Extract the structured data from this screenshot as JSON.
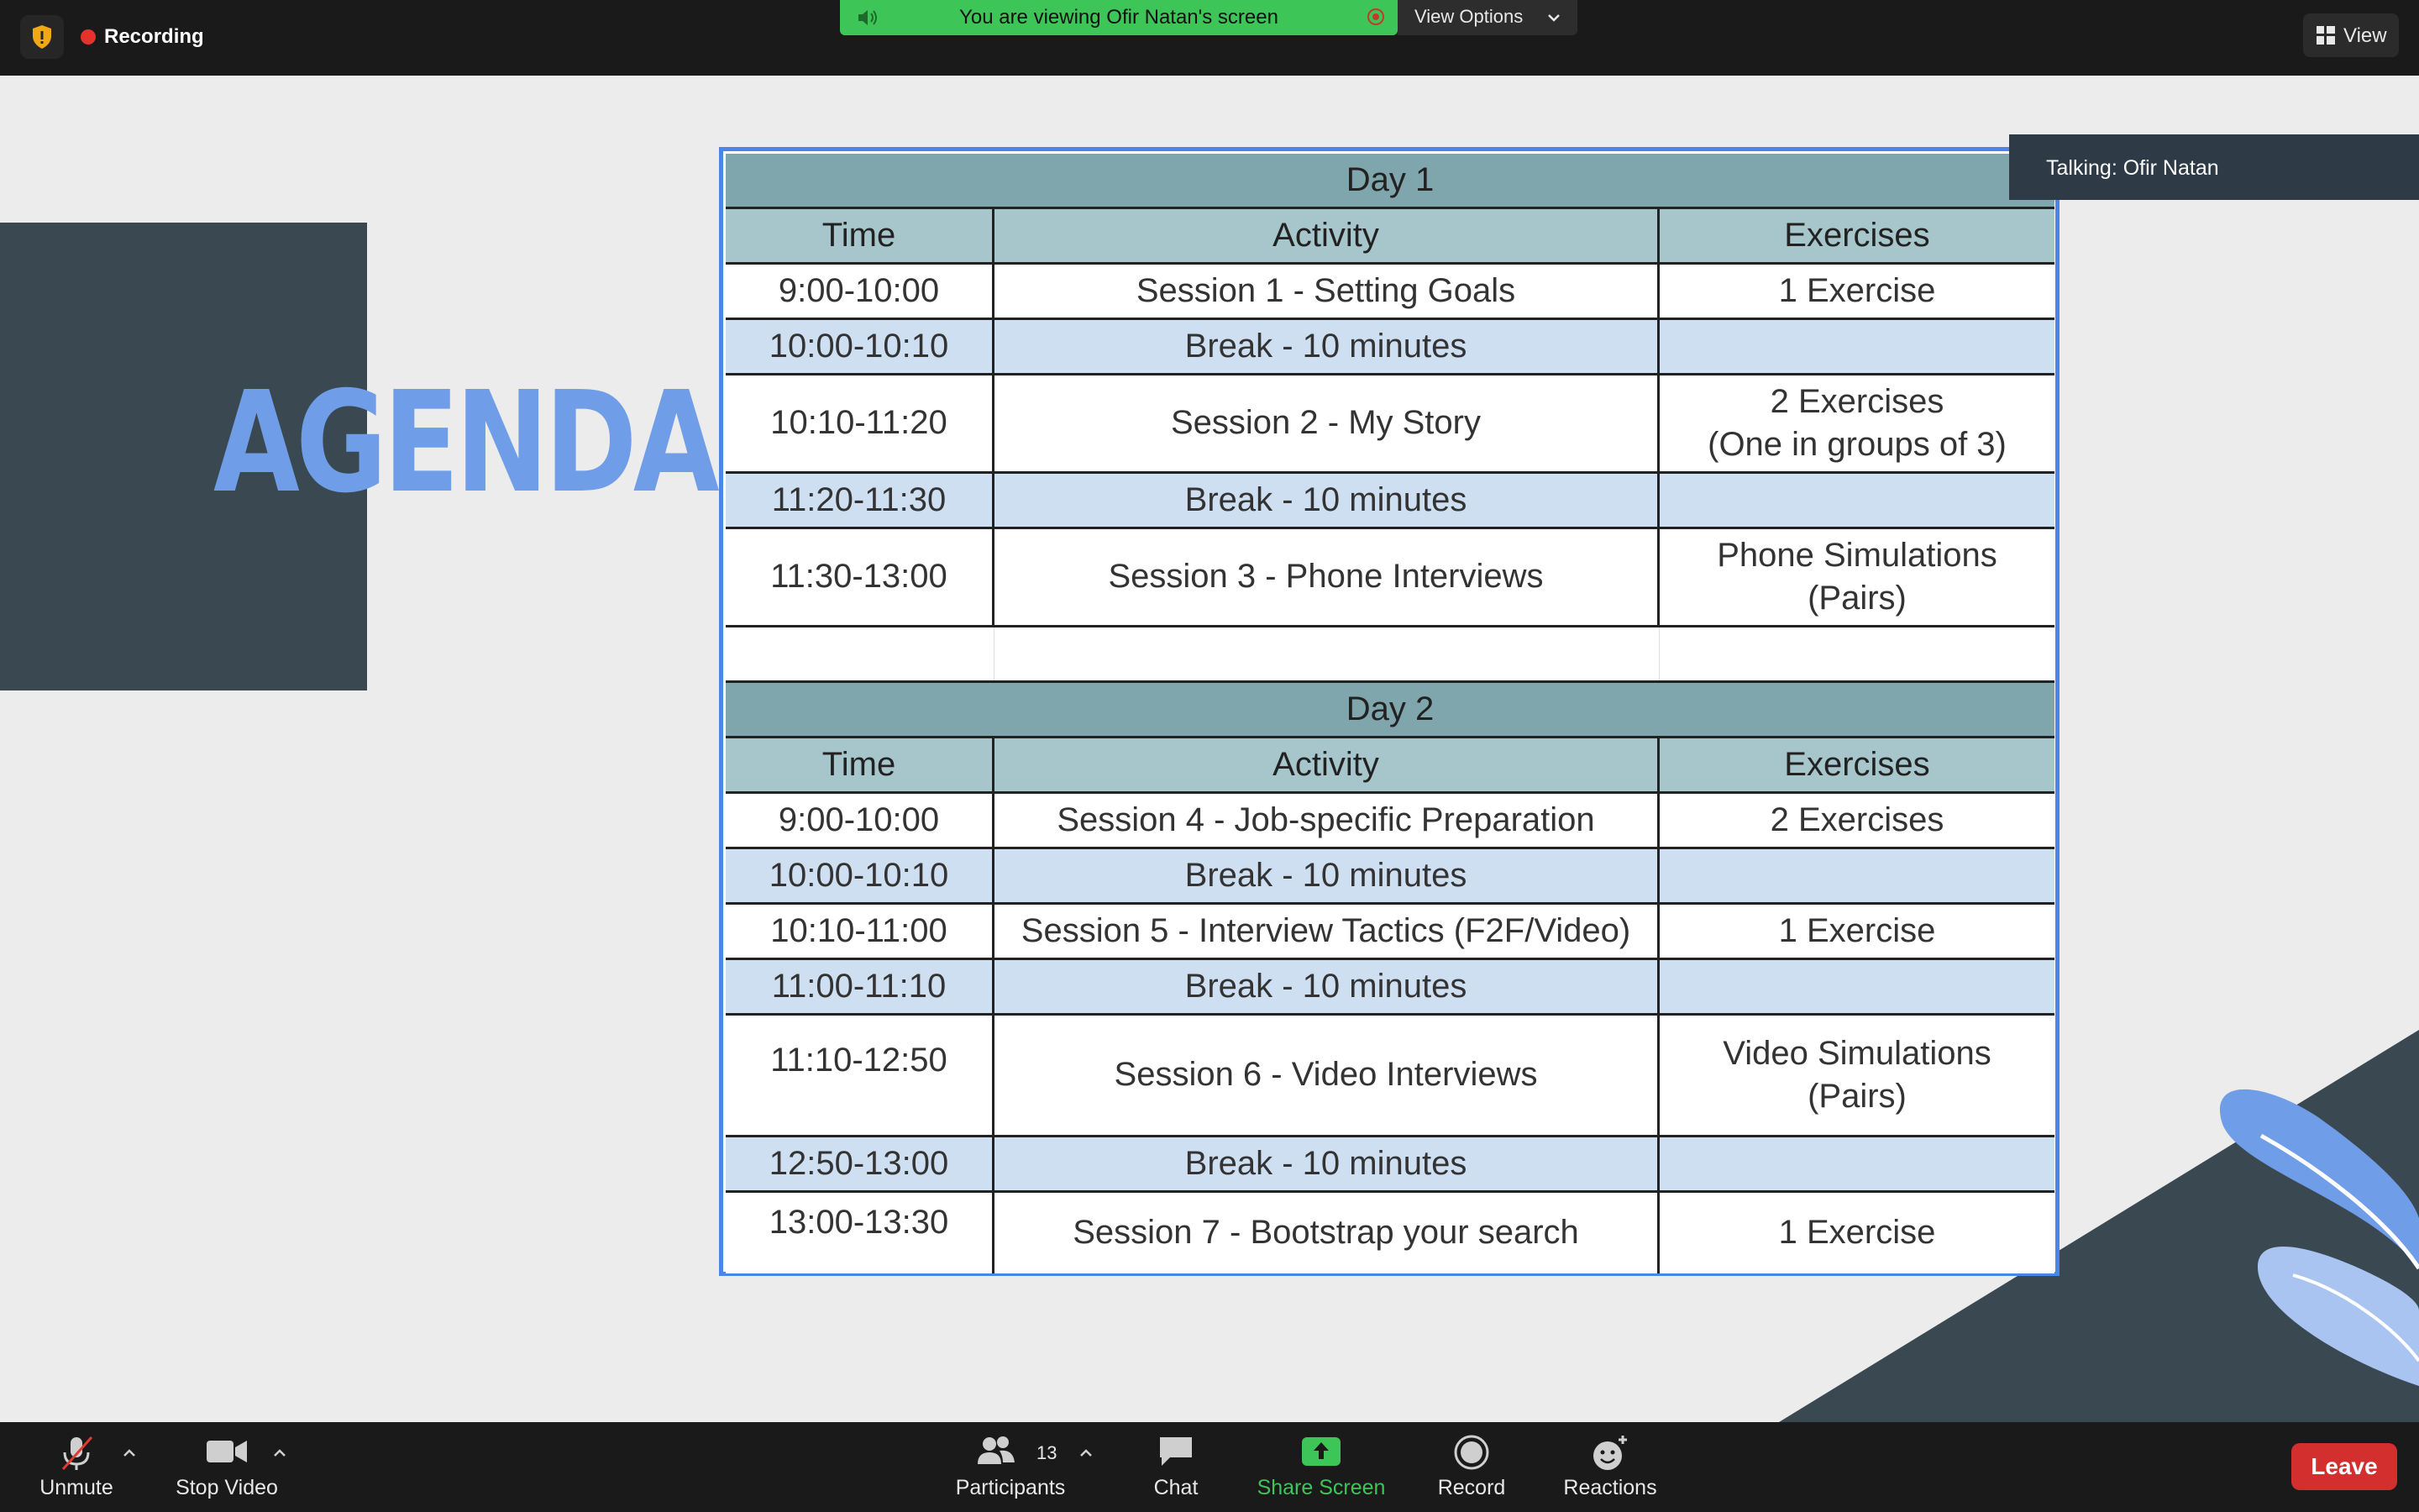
{
  "topbar": {
    "recording_label": "Recording",
    "banner_text": "You are viewing Ofir Natan's screen",
    "view_options_label": "View Options",
    "view_label": "View"
  },
  "slide": {
    "title": "AGENDA",
    "talking": "Talking: Ofir Natan",
    "accent_color": "#6f9de8",
    "dark_color": "#3a4852"
  },
  "schedule": {
    "day1": {
      "title": "Day 1",
      "headers": [
        "Time",
        "Activity",
        "Exercises"
      ],
      "rows": [
        {
          "time": "9:00-10:00",
          "activity": "Session 1 - Setting Goals",
          "exercises": "1 Exercise"
        },
        {
          "time": "10:00-10:10",
          "activity": "Break - 10 minutes",
          "exercises": ""
        },
        {
          "time": "10:10-11:20",
          "activity": "Session 2  - My Story",
          "exercises": "2 Exercises\n(One in groups of 3)"
        },
        {
          "time": "11:20-11:30",
          "activity": "Break - 10 minutes",
          "exercises": ""
        },
        {
          "time": "11:30-13:00",
          "activity": "Session 3 - Phone Interviews",
          "exercises": "Phone Simulations\n(Pairs)"
        }
      ]
    },
    "day2": {
      "title": "Day 2",
      "headers": [
        "Time",
        "Activity",
        "Exercises"
      ],
      "rows": [
        {
          "time": "9:00-10:00",
          "activity": "Session 4 - Job-specific Preparation",
          "exercises": "2 Exercises"
        },
        {
          "time": "10:00-10:10",
          "activity": "Break - 10 minutes",
          "exercises": ""
        },
        {
          "time": "10:10-11:00",
          "activity": "Session 5 - Interview Tactics (F2F/Video)",
          "exercises": "1 Exercise"
        },
        {
          "time": "11:00-11:10",
          "activity": "Break - 10 minutes",
          "exercises": ""
        },
        {
          "time": "11:10-12:50",
          "activity": "Session 6 - Video Interviews",
          "exercises": "Video Simulations\n(Pairs)"
        },
        {
          "time": "12:50-13:00",
          "activity": "Break - 10 minutes",
          "exercises": ""
        },
        {
          "time": "13:00-13:30",
          "activity": "Session 7 - Bootstrap your search",
          "exercises": "1 Exercise"
        }
      ]
    }
  },
  "toolbar": {
    "unmute_label": "Unmute",
    "stop_video_label": "Stop Video",
    "participants_label": "Participants",
    "participants_count": "13",
    "chat_label": "Chat",
    "share_label": "Share Screen",
    "record_label": "Record",
    "reactions_label": "Reactions",
    "leave_label": "Leave"
  }
}
